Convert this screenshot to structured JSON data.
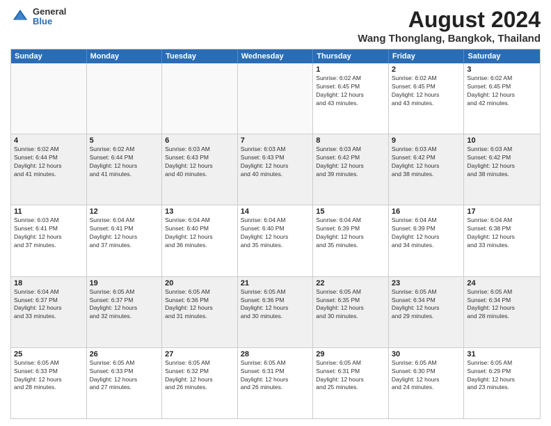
{
  "logo": {
    "general": "General",
    "blue": "Blue"
  },
  "title": "August 2024",
  "subtitle": "Wang Thonglang, Bangkok, Thailand",
  "header_days": [
    "Sunday",
    "Monday",
    "Tuesday",
    "Wednesday",
    "Thursday",
    "Friday",
    "Saturday"
  ],
  "rows": [
    [
      {
        "num": "",
        "empty": true
      },
      {
        "num": "",
        "empty": true
      },
      {
        "num": "",
        "empty": true
      },
      {
        "num": "",
        "empty": true
      },
      {
        "num": "1",
        "info": "Sunrise: 6:02 AM\nSunset: 6:45 PM\nDaylight: 12 hours\nand 43 minutes."
      },
      {
        "num": "2",
        "info": "Sunrise: 6:02 AM\nSunset: 6:45 PM\nDaylight: 12 hours\nand 43 minutes."
      },
      {
        "num": "3",
        "info": "Sunrise: 6:02 AM\nSunset: 6:45 PM\nDaylight: 12 hours\nand 42 minutes."
      }
    ],
    [
      {
        "num": "4",
        "shaded": true,
        "info": "Sunrise: 6:02 AM\nSunset: 6:44 PM\nDaylight: 12 hours\nand 41 minutes."
      },
      {
        "num": "5",
        "shaded": true,
        "info": "Sunrise: 6:02 AM\nSunset: 6:44 PM\nDaylight: 12 hours\nand 41 minutes."
      },
      {
        "num": "6",
        "shaded": true,
        "info": "Sunrise: 6:03 AM\nSunset: 6:43 PM\nDaylight: 12 hours\nand 40 minutes."
      },
      {
        "num": "7",
        "shaded": true,
        "info": "Sunrise: 6:03 AM\nSunset: 6:43 PM\nDaylight: 12 hours\nand 40 minutes."
      },
      {
        "num": "8",
        "shaded": true,
        "info": "Sunrise: 6:03 AM\nSunset: 6:42 PM\nDaylight: 12 hours\nand 39 minutes."
      },
      {
        "num": "9",
        "shaded": true,
        "info": "Sunrise: 6:03 AM\nSunset: 6:42 PM\nDaylight: 12 hours\nand 38 minutes."
      },
      {
        "num": "10",
        "shaded": true,
        "info": "Sunrise: 6:03 AM\nSunset: 6:42 PM\nDaylight: 12 hours\nand 38 minutes."
      }
    ],
    [
      {
        "num": "11",
        "info": "Sunrise: 6:03 AM\nSunset: 6:41 PM\nDaylight: 12 hours\nand 37 minutes."
      },
      {
        "num": "12",
        "info": "Sunrise: 6:04 AM\nSunset: 6:41 PM\nDaylight: 12 hours\nand 37 minutes."
      },
      {
        "num": "13",
        "info": "Sunrise: 6:04 AM\nSunset: 6:40 PM\nDaylight: 12 hours\nand 36 minutes."
      },
      {
        "num": "14",
        "info": "Sunrise: 6:04 AM\nSunset: 6:40 PM\nDaylight: 12 hours\nand 35 minutes."
      },
      {
        "num": "15",
        "info": "Sunrise: 6:04 AM\nSunset: 6:39 PM\nDaylight: 12 hours\nand 35 minutes."
      },
      {
        "num": "16",
        "info": "Sunrise: 6:04 AM\nSunset: 6:39 PM\nDaylight: 12 hours\nand 34 minutes."
      },
      {
        "num": "17",
        "info": "Sunrise: 6:04 AM\nSunset: 6:38 PM\nDaylight: 12 hours\nand 33 minutes."
      }
    ],
    [
      {
        "num": "18",
        "shaded": true,
        "info": "Sunrise: 6:04 AM\nSunset: 6:37 PM\nDaylight: 12 hours\nand 33 minutes."
      },
      {
        "num": "19",
        "shaded": true,
        "info": "Sunrise: 6:05 AM\nSunset: 6:37 PM\nDaylight: 12 hours\nand 32 minutes."
      },
      {
        "num": "20",
        "shaded": true,
        "info": "Sunrise: 6:05 AM\nSunset: 6:36 PM\nDaylight: 12 hours\nand 31 minutes."
      },
      {
        "num": "21",
        "shaded": true,
        "info": "Sunrise: 6:05 AM\nSunset: 6:36 PM\nDaylight: 12 hours\nand 30 minutes."
      },
      {
        "num": "22",
        "shaded": true,
        "info": "Sunrise: 6:05 AM\nSunset: 6:35 PM\nDaylight: 12 hours\nand 30 minutes."
      },
      {
        "num": "23",
        "shaded": true,
        "info": "Sunrise: 6:05 AM\nSunset: 6:34 PM\nDaylight: 12 hours\nand 29 minutes."
      },
      {
        "num": "24",
        "shaded": true,
        "info": "Sunrise: 6:05 AM\nSunset: 6:34 PM\nDaylight: 12 hours\nand 28 minutes."
      }
    ],
    [
      {
        "num": "25",
        "info": "Sunrise: 6:05 AM\nSunset: 6:33 PM\nDaylight: 12 hours\nand 28 minutes."
      },
      {
        "num": "26",
        "info": "Sunrise: 6:05 AM\nSunset: 6:33 PM\nDaylight: 12 hours\nand 27 minutes."
      },
      {
        "num": "27",
        "info": "Sunrise: 6:05 AM\nSunset: 6:32 PM\nDaylight: 12 hours\nand 26 minutes."
      },
      {
        "num": "28",
        "info": "Sunrise: 6:05 AM\nSunset: 6:31 PM\nDaylight: 12 hours\nand 26 minutes."
      },
      {
        "num": "29",
        "info": "Sunrise: 6:05 AM\nSunset: 6:31 PM\nDaylight: 12 hours\nand 25 minutes."
      },
      {
        "num": "30",
        "info": "Sunrise: 6:05 AM\nSunset: 6:30 PM\nDaylight: 12 hours\nand 24 minutes."
      },
      {
        "num": "31",
        "info": "Sunrise: 6:05 AM\nSunset: 6:29 PM\nDaylight: 12 hours\nand 23 minutes."
      }
    ]
  ]
}
